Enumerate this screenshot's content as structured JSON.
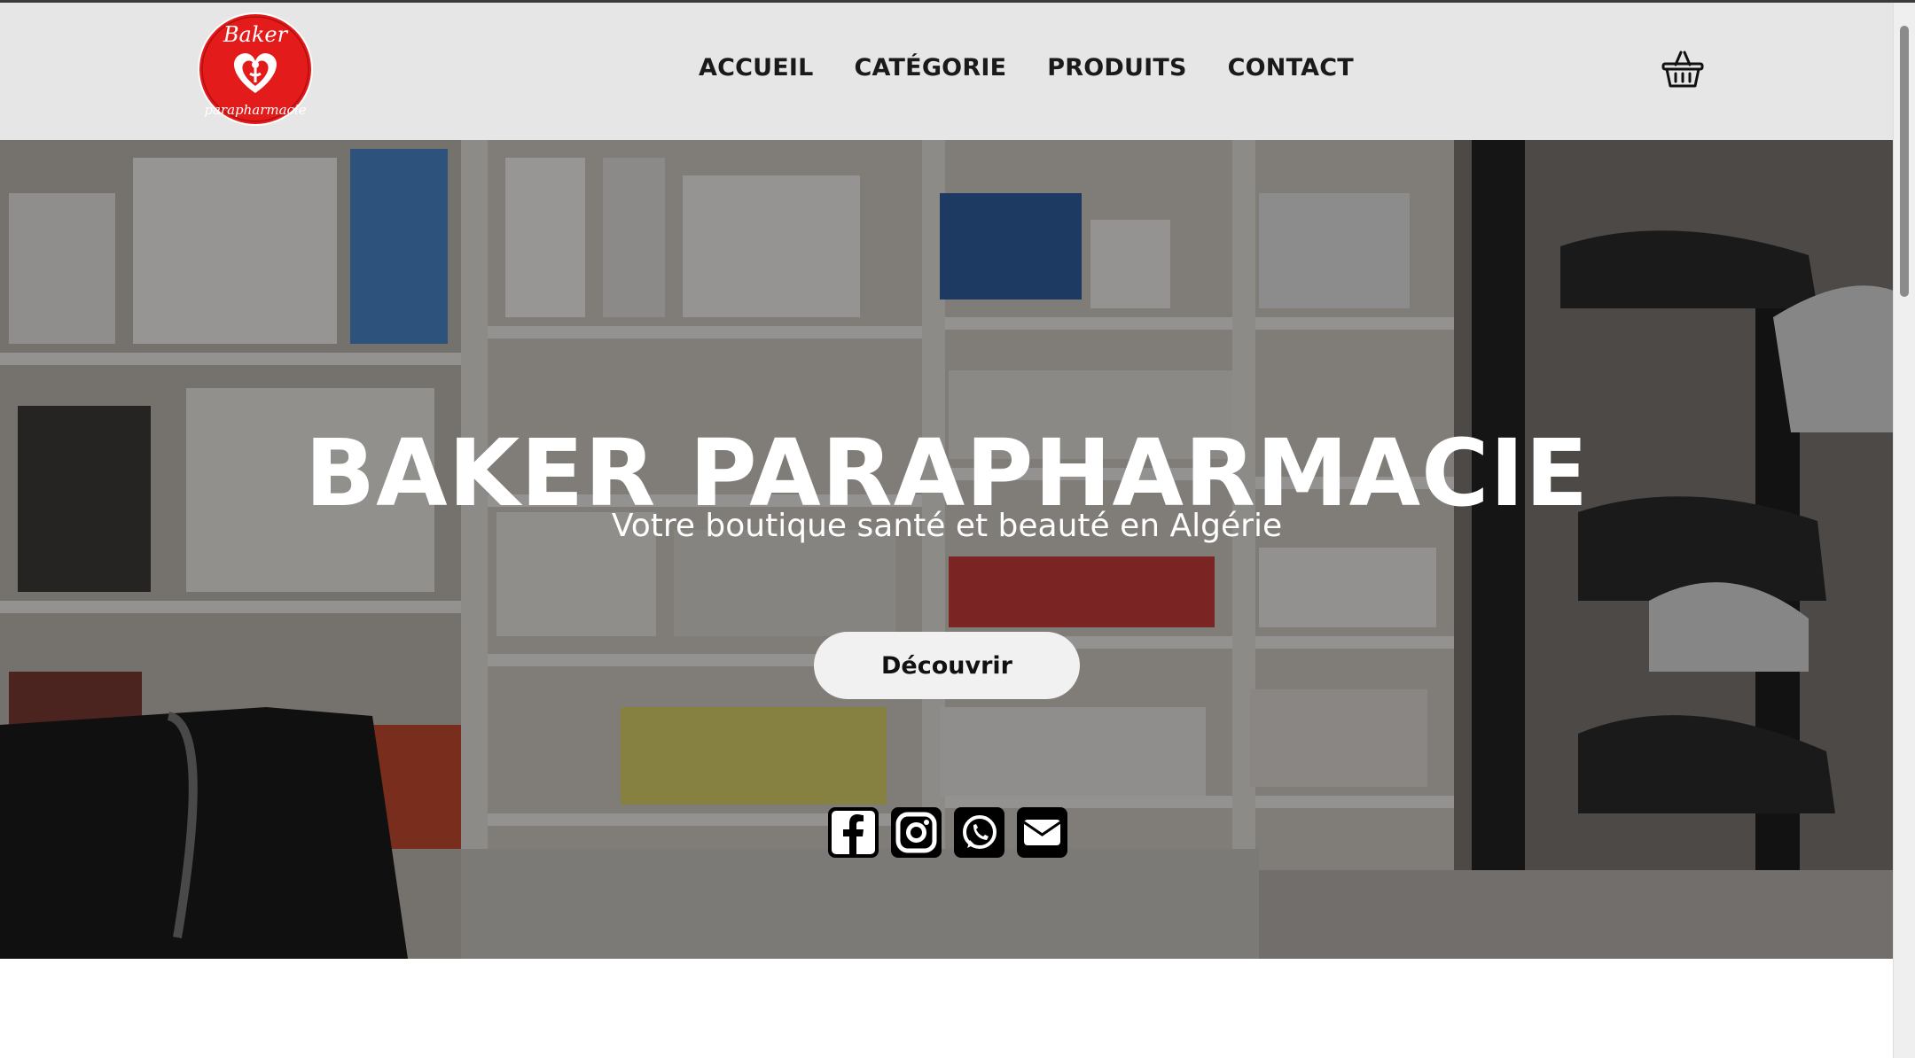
{
  "brand": {
    "logo_line1": "Baker",
    "logo_line2": "parapharmacie",
    "logo_color": "#e41b1b"
  },
  "nav": {
    "items": [
      {
        "label": "ACCUEIL"
      },
      {
        "label": "CATÉGORIE"
      },
      {
        "label": "PRODUITS"
      },
      {
        "label": "CONTACT"
      }
    ],
    "cart_icon": "basket-icon"
  },
  "hero": {
    "title": "BAKER PARAPHARMACIE",
    "subtitle": "Votre boutique santé et beauté en Algérie",
    "cta_label": "Découvrir",
    "socials": [
      {
        "icon": "facebook-icon"
      },
      {
        "icon": "instagram-icon"
      },
      {
        "icon": "whatsapp-icon"
      },
      {
        "icon": "email-icon"
      }
    ]
  },
  "colors": {
    "header_bg": "#e6e6e6",
    "hero_text": "#ffffff",
    "button_bg": "#f1f1f1"
  }
}
